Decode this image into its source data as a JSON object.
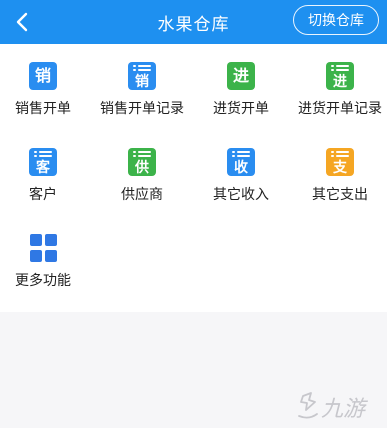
{
  "header": {
    "title": "水果仓库",
    "switch_label": "切换仓库"
  },
  "colors": {
    "header_bg": "#1e90f0",
    "blue": "#2a8df0",
    "green": "#3cb34a",
    "orange": "#f5a623"
  },
  "menu": [
    {
      "label": "销售开单",
      "icon_text": "销",
      "icon_style": "plain",
      "color": "blue"
    },
    {
      "label": "销售开单记录",
      "icon_text": "销",
      "icon_style": "list",
      "color": "blue"
    },
    {
      "label": "进货开单",
      "icon_text": "进",
      "icon_style": "plain",
      "color": "green"
    },
    {
      "label": "进货开单记录",
      "icon_text": "进",
      "icon_style": "list",
      "color": "green"
    },
    {
      "label": "客户",
      "icon_text": "客",
      "icon_style": "list",
      "color": "blue"
    },
    {
      "label": "供应商",
      "icon_text": "供",
      "icon_style": "list",
      "color": "green"
    },
    {
      "label": "其它收入",
      "icon_text": "收",
      "icon_style": "list",
      "color": "blue"
    },
    {
      "label": "其它支出",
      "icon_text": "支",
      "icon_style": "list",
      "color": "orange"
    },
    {
      "label": "更多功能",
      "icon_text": "",
      "icon_style": "grid",
      "color": "blue"
    }
  ],
  "watermark": {
    "text": "九游"
  }
}
